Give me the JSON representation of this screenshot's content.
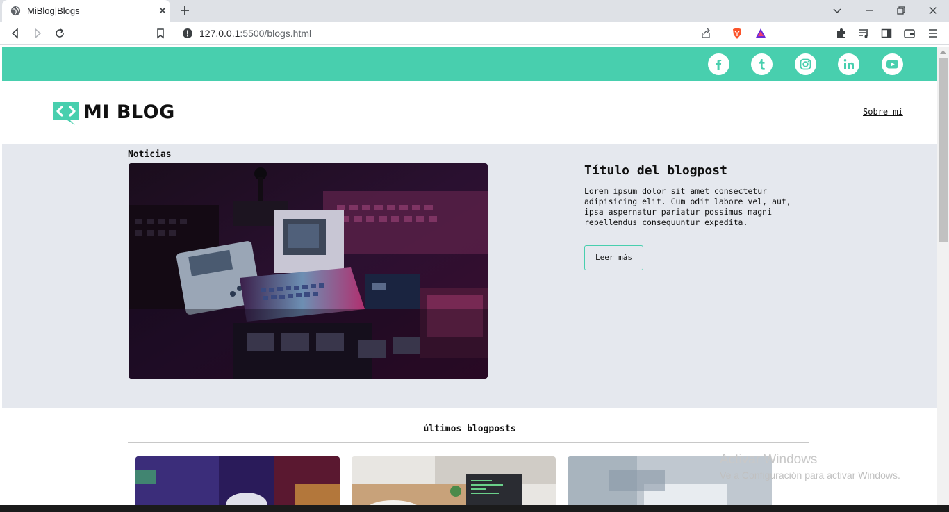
{
  "browser": {
    "tab_title": "MiBlog|Blogs",
    "url_host": "127.0.0.1",
    "url_rest": ":5500/blogs.html"
  },
  "site": {
    "logo_text": "MI BLOG",
    "nav_about": "Sobre mí",
    "accent_color": "#48cfae",
    "social": [
      "facebook-icon",
      "tumblr-icon",
      "instagram-icon",
      "linkedin-icon",
      "youtube-icon"
    ]
  },
  "news": {
    "label": "Noticias",
    "post_title": "Título del blogpost",
    "post_body": "Lorem ipsum dolor sit amet consectetur adipisicing elit. Cum odit labore vel, aut, ipsa aspernatur pariatur possimus magni repellendus consequuntur expedita.",
    "button_label": "Leer más"
  },
  "latest": {
    "title": "últimos blogposts"
  },
  "os": {
    "watermark_title": "Activar Windows",
    "watermark_sub": "Ve a Configuración para activar Windows."
  }
}
